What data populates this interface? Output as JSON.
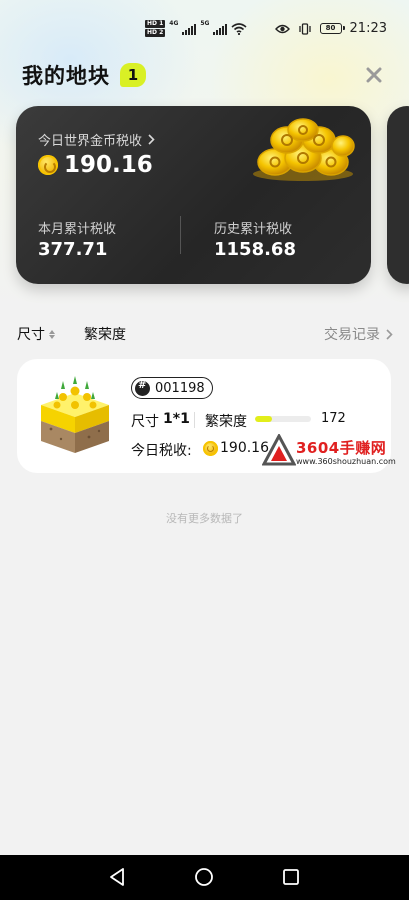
{
  "status_bar": {
    "hd1": "HD 1",
    "hd2": "HD 2",
    "net1": "4G",
    "net2": "5G",
    "battery": "80",
    "time": "21:23"
  },
  "header": {
    "title": "我的地块",
    "count": "1"
  },
  "summary": {
    "today_label": "今日世界金币税收",
    "today_value": "190.16",
    "month_label": "本月累计税收",
    "month_value": "377.71",
    "history_label": "历史累计税收",
    "history_value": "1158.68"
  },
  "filters": {
    "size": "尺寸",
    "prosperity": "繁荣度",
    "trade_log": "交易记录"
  },
  "land_items": [
    {
      "id": "001198",
      "size_label": "尺寸",
      "size_value": "1*1",
      "prosperity_label": "繁荣度",
      "prosperity_value": "172",
      "prosperity_fraction": 0.3,
      "tax_label": "今日税收:",
      "tax_value": "190.16"
    }
  ],
  "watermark": {
    "title": "3604手赚网",
    "url": "www.360shouzhuan.com"
  },
  "footer": {
    "no_more": "没有更多数据了"
  },
  "icons": {
    "close": "close-icon",
    "coin": "gold-coin-icon",
    "back": "back-triangle-icon",
    "home": "home-circle-icon",
    "recent": "recent-square-icon"
  },
  "colors": {
    "accent": "#d9f025",
    "card_dark": "#2b2b2b",
    "watermark_red": "#e02020"
  }
}
